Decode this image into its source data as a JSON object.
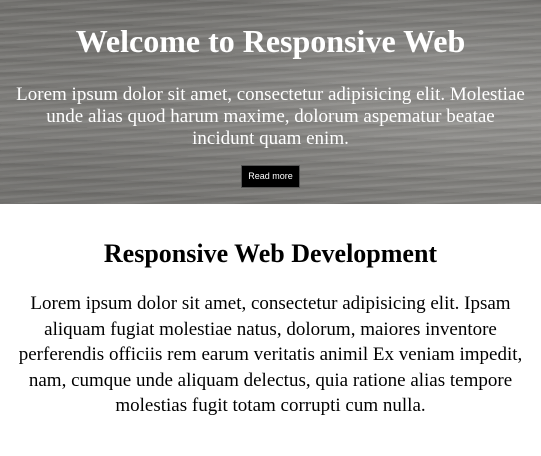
{
  "hero": {
    "title": "Welcome to Responsive Web",
    "text": "Lorem ipsum dolor sit amet, consectetur adipisicing elit. Molestiae unde alias quod harum maxime, dolorum aspematur beatae incidunt quam enim.",
    "button_label": "Read more"
  },
  "main": {
    "title": "Responsive Web Development",
    "text": "Lorem ipsum dolor sit amet, consectetur adipisicing elit. Ipsam aliquam fugiat molestiae natus, dolorum, maiores inventore perferendis officiis rem earum veritatis animil Ex veniam impedit, nam, cumque unde aliquam delectus, quia ratione alias tempore molestias fugit totam corrupti cum nulla."
  }
}
